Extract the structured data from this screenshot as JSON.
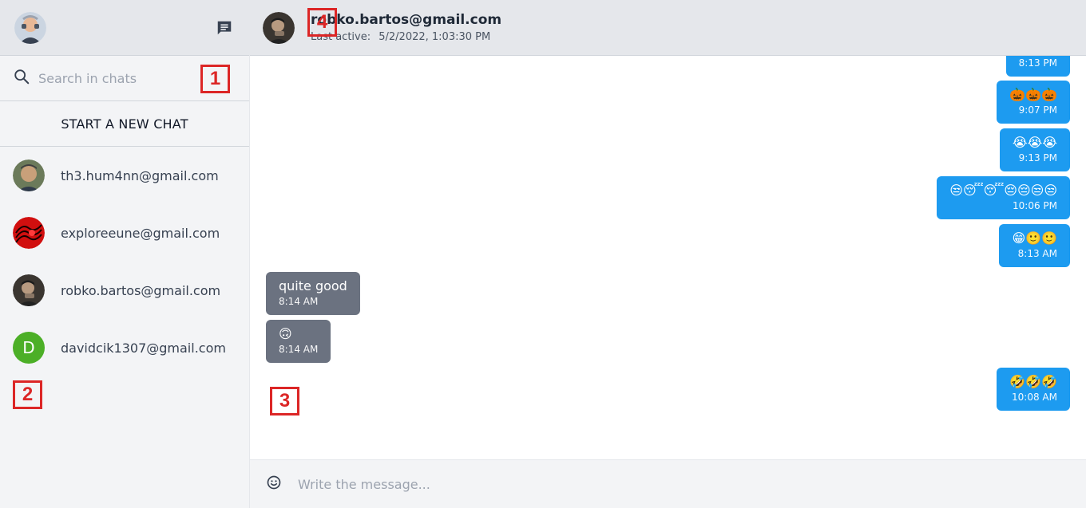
{
  "sidebar": {
    "search_placeholder": "Search in chats",
    "start_chat_label": "START A NEW CHAT",
    "conversations": [
      {
        "email": "th3.hum4nn@gmail.com",
        "avatar": "photo"
      },
      {
        "email": "exploreeune@gmail.com",
        "avatar": "photo"
      },
      {
        "email": "robko.bartos@gmail.com",
        "avatar": "photo"
      },
      {
        "email": "davidcik1307@gmail.com",
        "avatar_letter": "D",
        "avatar_color": "#4caf27"
      }
    ]
  },
  "chat": {
    "title": "robko.bartos@gmail.com",
    "last_active_label": "Last active:",
    "last_active_value": "5/2/2022, 1:03:30 PM",
    "messages": [
      {
        "dir": "out",
        "body": "",
        "time": "8:13 PM"
      },
      {
        "dir": "out",
        "body": "🎃🎃🎃",
        "time": "9:07 PM"
      },
      {
        "dir": "out",
        "body": "😭😭😭",
        "time": "9:13 PM"
      },
      {
        "dir": "out",
        "body": "😒😴😴😔😔😒😒",
        "time": "10:06 PM"
      },
      {
        "dir": "out",
        "body": "😁🙂🙂",
        "time": "8:13 AM"
      },
      {
        "dir": "in",
        "body": "quite good",
        "time": "8:14 AM"
      },
      {
        "dir": "in",
        "body": "🙃",
        "time": "8:14 AM"
      },
      {
        "dir": "out",
        "body": "🤣🤣🤣",
        "time": "10:08 AM"
      }
    ]
  },
  "composer": {
    "placeholder": "Write the message..."
  },
  "badges": [
    "1",
    "2",
    "3",
    "4"
  ],
  "colors": {
    "outgoing": "#1d9bf0",
    "incoming": "#6b7280",
    "badge": "#dc2626"
  }
}
